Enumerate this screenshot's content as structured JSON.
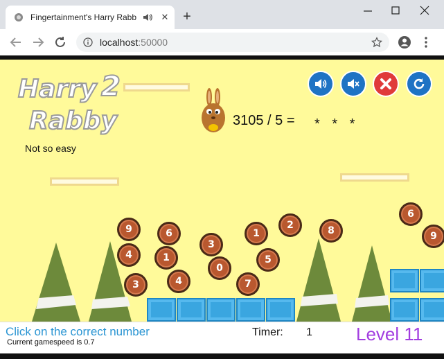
{
  "browser": {
    "tab_title": "Fingertainment's Harry Rabb",
    "tab_audio_icon": "speaker-icon",
    "new_tab_symbol": "+",
    "url_host": "localhost",
    "url_port": ":50000",
    "theme_colors": {
      "chrome": "#dee1e6",
      "toolbar": "#ffffff",
      "omnibox": "#f1f3f4"
    }
  },
  "game": {
    "logo_line1": "Harry",
    "logo_number": "2",
    "logo_line2": "Rabby",
    "question": "3105 / 5 =",
    "answer_mask": "* * *",
    "difficulty": "Not so easy",
    "background_color": "#fffa9a",
    "controls": [
      {
        "name": "sound-on-button",
        "icon": "speaker-on-icon",
        "color": "#1f73c4"
      },
      {
        "name": "sound-off-button",
        "icon": "speaker-mute-icon",
        "color": "#1f73c4"
      },
      {
        "name": "close-game-button",
        "icon": "close-icon",
        "color": "#e03a3a"
      },
      {
        "name": "restart-button",
        "icon": "refresh-icon",
        "color": "#1f73c4"
      }
    ],
    "numbers": [
      "9",
      "6",
      "3",
      "1",
      "2",
      "8",
      "6",
      "9",
      "4",
      "1",
      "0",
      "5",
      "3",
      "4",
      "7"
    ],
    "number_color": "#b9582f"
  },
  "status": {
    "instruction": "Click on the correct number",
    "speed": "Current gamespeed is 0.7",
    "timer_label": "Timer:",
    "timer_value": "1",
    "level": "Level 11",
    "instruction_color": "#2a95d3",
    "level_color": "#a23de0"
  }
}
